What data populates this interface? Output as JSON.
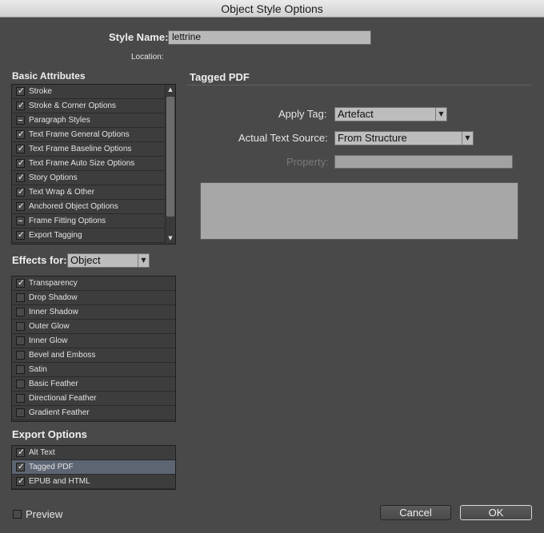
{
  "window": {
    "title": "Object Style Options"
  },
  "style_name": {
    "label": "Style Name:",
    "value": "lettrine"
  },
  "location": {
    "label": "Location:"
  },
  "basic_attributes": {
    "heading": "Basic Attributes",
    "items": [
      {
        "label": "Stroke",
        "state": "checked"
      },
      {
        "label": "Stroke & Corner Options",
        "state": "checked"
      },
      {
        "label": "Paragraph Styles",
        "state": "ignored"
      },
      {
        "label": "Text Frame General Options",
        "state": "checked"
      },
      {
        "label": "Text Frame Baseline Options",
        "state": "checked"
      },
      {
        "label": "Text Frame Auto Size Options",
        "state": "checked"
      },
      {
        "label": "Story Options",
        "state": "checked"
      },
      {
        "label": "Text Wrap & Other",
        "state": "checked"
      },
      {
        "label": "Anchored Object Options",
        "state": "checked"
      },
      {
        "label": "Frame Fitting Options",
        "state": "ignored"
      },
      {
        "label": "Export Tagging",
        "state": "checked"
      }
    ]
  },
  "effects_for": {
    "label": "Effects for:",
    "value": "Object",
    "items": [
      {
        "label": "Transparency",
        "state": "checked"
      },
      {
        "label": "Drop Shadow",
        "state": "unchecked"
      },
      {
        "label": "Inner Shadow",
        "state": "unchecked"
      },
      {
        "label": "Outer Glow",
        "state": "unchecked"
      },
      {
        "label": "Inner Glow",
        "state": "unchecked"
      },
      {
        "label": "Bevel and Emboss",
        "state": "unchecked"
      },
      {
        "label": "Satin",
        "state": "unchecked"
      },
      {
        "label": "Basic Feather",
        "state": "unchecked"
      },
      {
        "label": "Directional Feather",
        "state": "unchecked"
      },
      {
        "label": "Gradient Feather",
        "state": "unchecked"
      }
    ]
  },
  "export_options": {
    "heading": "Export Options",
    "items": [
      {
        "label": "Alt Text",
        "state": "checked"
      },
      {
        "label": "Tagged PDF",
        "state": "checked",
        "selected": true
      },
      {
        "label": "EPUB and HTML",
        "state": "checked"
      }
    ]
  },
  "panel": {
    "heading": "Tagged PDF",
    "apply_tag": {
      "label": "Apply Tag:",
      "value": "Artefact"
    },
    "actual_text_source": {
      "label": "Actual Text Source:",
      "value": "From Structure"
    },
    "property": {
      "label": "Property:",
      "value": ""
    }
  },
  "footer": {
    "preview": {
      "label": "Preview",
      "checked": false
    },
    "cancel_label": "Cancel",
    "ok_label": "OK"
  },
  "icons": {
    "check": "checkmark-icon",
    "ignored": "dash-icon",
    "dropdown": "chevron-down-icon",
    "scroll_up": "triangle-up-icon",
    "scroll_down": "triangle-down-icon"
  },
  "colors": {
    "dialog_bg": "#494949",
    "list_bg": "#3d3d3d",
    "selected_row": "#5d6472",
    "field_bg": "#b8b8b8"
  }
}
